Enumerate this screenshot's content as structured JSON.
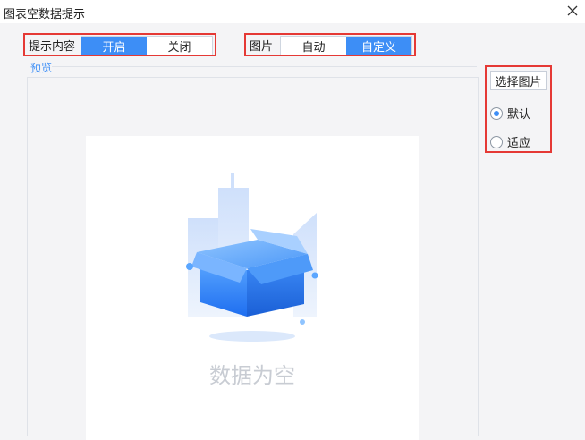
{
  "window": {
    "title": "图表空数据提示"
  },
  "hint_content": {
    "label": "提示内容",
    "options": [
      "开启",
      "关闭"
    ],
    "selected": "开启"
  },
  "image": {
    "label": "图片",
    "options": [
      "自动",
      "自定义"
    ],
    "selected": "自定义"
  },
  "preview": {
    "label": "预览",
    "empty_text": "数据为空"
  },
  "side_panel": {
    "choose_button": "选择图片",
    "radio_options": [
      {
        "label": "默认",
        "checked": true
      },
      {
        "label": "适应",
        "checked": false
      }
    ]
  },
  "colors": {
    "accent": "#3d8ef6",
    "highlight_border": "#e53935"
  }
}
